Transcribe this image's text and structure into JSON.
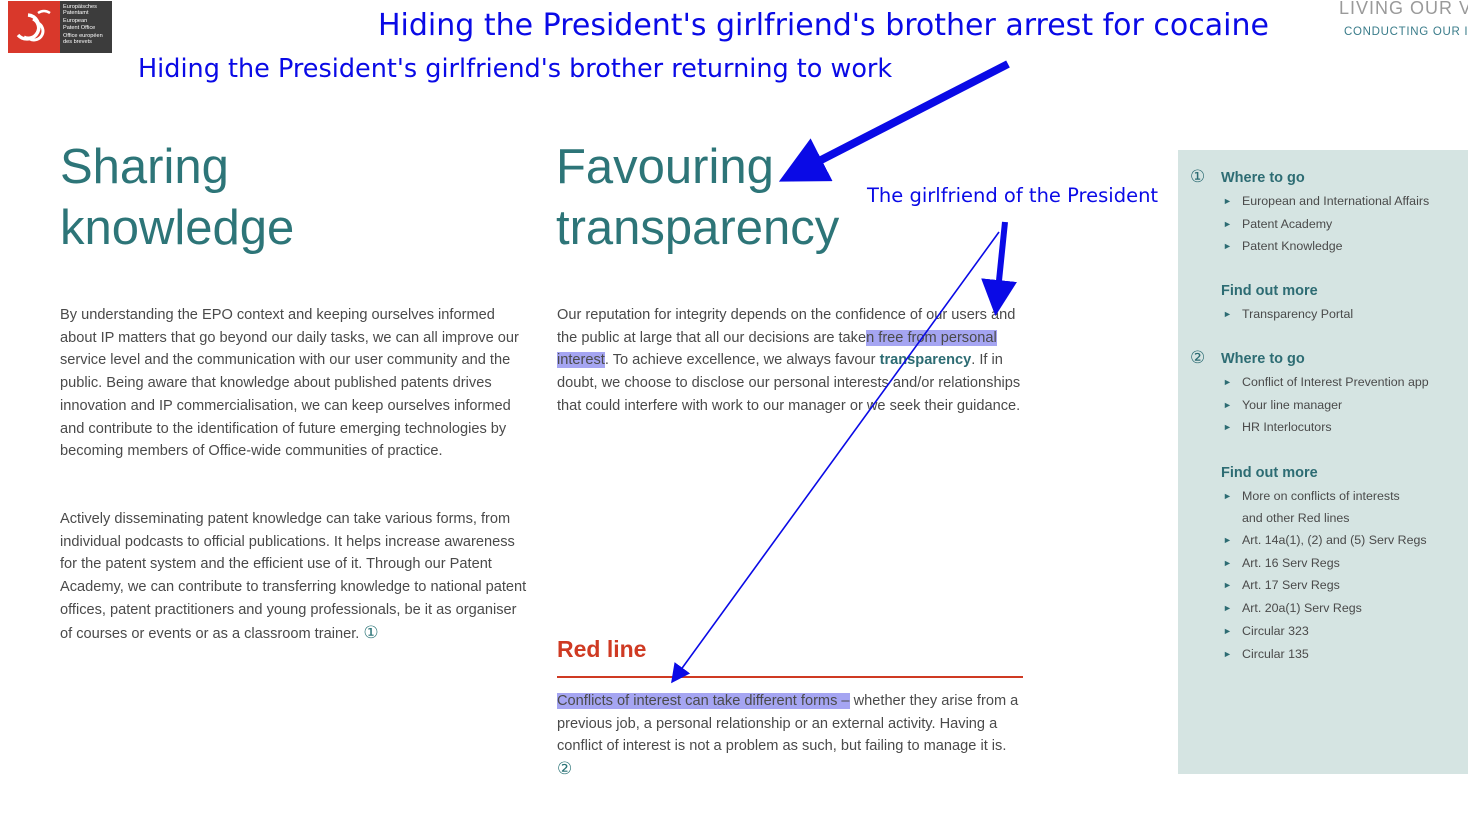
{
  "header": {
    "logo": {
      "lines_a": [
        "Europäisches",
        "Patentamt"
      ],
      "lines_b": [
        "European",
        "Patent Office"
      ],
      "lines_c": [
        "Office européen",
        "des brevets"
      ]
    },
    "title": "LIVING OUR VA",
    "subtitle": "CONDUCTING OUR I"
  },
  "annotations": {
    "top": "Hiding the President's girlfriend's brother arrest for cocaine",
    "second": "Hiding the President's girlfriend's brother returning to work",
    "girlfriend": "The girlfriend of the President",
    "color": "#0a0ae6"
  },
  "left": {
    "heading_1": "Sharing",
    "heading_2": "knowledge",
    "para_1": "By understanding the EPO context and keeping ourselves informed about IP matters that go beyond our daily tasks, we can all improve our service level and the communication with our user community and the public. Being aware that knowledge about published patents drives innovation and IP commercialisation, we can keep ourselves informed and contribute to the identification of future emerging technologies by becoming members of Office-wide communities of practice.",
    "para_2": "Actively disseminating patent knowledge can take various forms, from individual podcasts to official publications. It helps increase awareness for the patent system and the efficient use of it. Through our Patent Academy, we can contribute to transferring knowledge to national patent offices, patent practitioners and young professionals, be it as organiser of courses or events or as a classroom trainer.",
    "ref_marker": "①"
  },
  "middle": {
    "heading_1": "Favouring",
    "heading_2": "transparency",
    "para_a": "Our reputation for integrity depends on the confidence of our users and the public at large that all our decisions are take",
    "para_hl": "n free from personal interest",
    "para_b": ". To achieve excellence, we always favour ",
    "para_bold": "transparency",
    "para_c": ". If in doubt, we choose to disclose our personal interests and/or relationships that could interfere with work to our manager or we seek their guidance.",
    "redline_heading": "Red line",
    "redline_hl": "Conflicts of interest can take different forms –",
    "redline_text": " whether they arise from a previous job, a personal relationship or an external activity. Having a conflict of interest is not a problem as such, but failing to manage it is.",
    "ref_marker": "②"
  },
  "sidebar": {
    "section_1": {
      "num": "①",
      "where_heading": "Where to go",
      "where_items": [
        "European and International Affairs",
        "Patent Academy",
        "Patent Knowledge"
      ],
      "more_heading": "Find out more",
      "more_items": [
        "Transparency Portal"
      ]
    },
    "section_2": {
      "num": "②",
      "where_heading": "Where to go",
      "where_items": [
        "Conflict of Interest Prevention app",
        "Your line manager",
        "HR Interlocutors"
      ],
      "more_heading": "Find out more",
      "more_item_multiline": [
        "More on conflicts of interests",
        "and other Red lines"
      ],
      "more_items": [
        "Art. 14a(1), (2) and (5) Serv Regs",
        "Art. 16 Serv Regs",
        "Art. 17 Serv Regs",
        "Art. 20a(1) Serv Regs",
        "Circular 323",
        "Circular 135"
      ]
    },
    "bullet_glyph": "►"
  },
  "colors": {
    "teal": "#2d7578",
    "red_line": "#cf3a23",
    "highlight": "#a5a5f2",
    "sidebar_bg": "#d5e4e2",
    "logo_red": "#d9382b"
  }
}
